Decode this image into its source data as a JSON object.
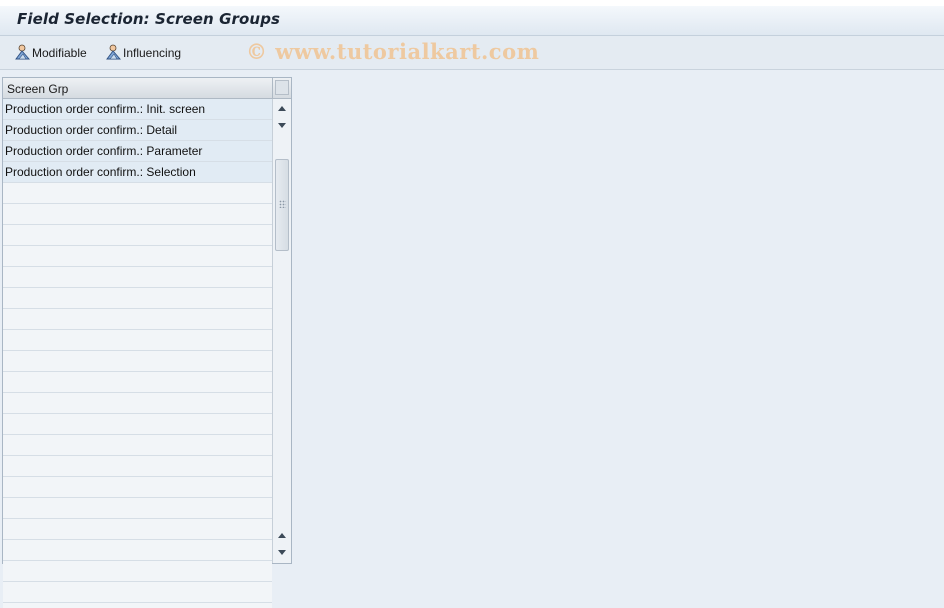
{
  "window": {
    "title": "Field Selection: Screen Groups"
  },
  "toolbar": {
    "modifiable_label": "Modifiable",
    "influencing_label": "Influencing",
    "watermark": "© www.tutorialkart.com"
  },
  "table": {
    "column_header": "Screen Grp",
    "rows": [
      "Production order confirm.: Init. screen",
      "Production order confirm.: Detail",
      "Production order confirm.: Parameter",
      "Production order confirm.: Selection"
    ]
  },
  "icons": {
    "modifiable": "user-mountain-icon",
    "influencing": "user-mountain-icon"
  }
}
